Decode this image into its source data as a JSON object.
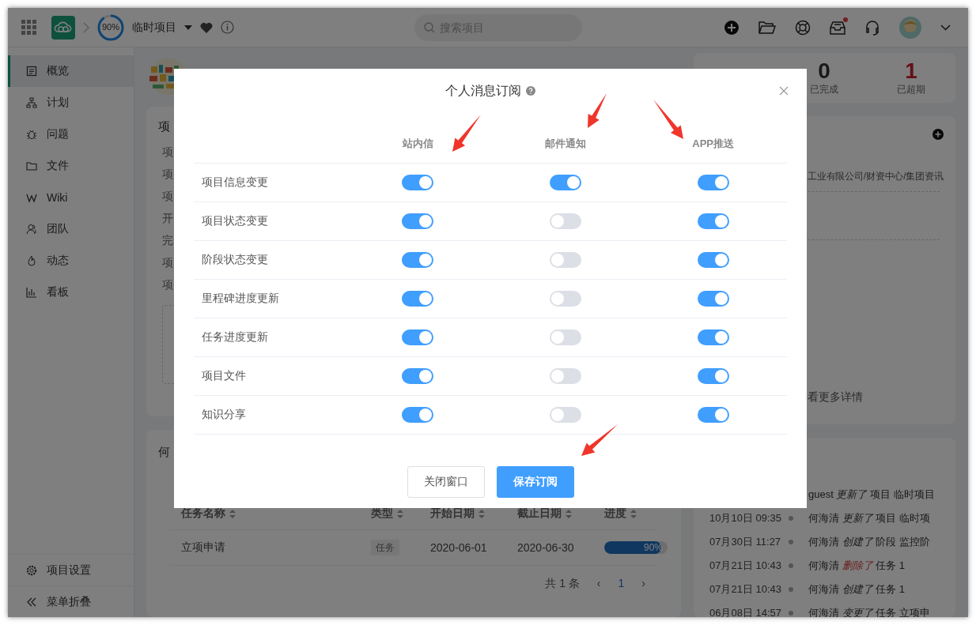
{
  "topbar": {
    "progress": {
      "level": 0.9,
      "label": "90%"
    },
    "project": "临时项目",
    "search": {
      "placeholder": "搜索项目"
    },
    "notification_dot": true
  },
  "sidebar": {
    "items": [
      {
        "label": "概览",
        "selected": true
      },
      {
        "label": "计划",
        "selected": false
      },
      {
        "label": "问题",
        "selected": false
      },
      {
        "label": "文件",
        "selected": false
      },
      {
        "label": "Wiki",
        "selected": false
      },
      {
        "label": "团队",
        "selected": false
      },
      {
        "label": "动态",
        "selected": false
      },
      {
        "label": "看板",
        "selected": false
      }
    ],
    "footer": [
      {
        "label": "项目设置"
      },
      {
        "label": "菜单折叠"
      }
    ]
  },
  "info_card": {
    "title": "项",
    "fields": [
      "项",
      "项",
      "项",
      "开",
      "完",
      "项",
      "项"
    ]
  },
  "stats": [
    {
      "value": "0",
      "label": "已完成",
      "kind": "normal"
    },
    {
      "value": "1",
      "label": "已超期",
      "kind": "overdue"
    }
  ],
  "org_card": {
    "path": "工业有限公司/财资中心/集团资讯",
    "more": "看更多详情"
  },
  "task_card": {
    "title": "何",
    "columns": [
      "任务名称",
      "类型",
      "开始日期",
      "截止日期",
      "进度"
    ],
    "rows": [
      {
        "name": "立项申请",
        "type": "任务",
        "start": "2020-06-01",
        "end": "2020-06-30",
        "level": 0.9,
        "progress": "90%"
      }
    ],
    "pagination": {
      "total": "共 1 条",
      "prev": "‹",
      "page": "1",
      "next": "›"
    }
  },
  "activity": [
    {
      "actor": "guest",
      "verb": "更新了",
      "kind": "normal",
      "object": "项目 临时项目"
    },
    {
      "time": "10月10日 09:35",
      "actor": "何海清",
      "verb": "更新了",
      "kind": "normal",
      "object": "项目 临时项"
    },
    {
      "time": "07月30日 11:27",
      "actor": "何海清",
      "verb": "创建了",
      "kind": "normal",
      "object": "阶段 监控阶"
    },
    {
      "time": "07月21日 10:43",
      "actor": "何海清",
      "verb": "删除了",
      "kind": "delete",
      "object": "任务 1"
    },
    {
      "time": "07月21日 10:43",
      "actor": "何海清",
      "verb": "创建了",
      "kind": "normal",
      "object": "任务 1"
    },
    {
      "time": "06月08日 14:57",
      "actor": "何海清",
      "verb": "变更了",
      "kind": "normal",
      "object": "任务 立项申"
    }
  ],
  "dialog": {
    "title": "个人消息订阅",
    "channels": [
      "站内信",
      "邮件通知",
      "APP推送"
    ],
    "rows": [
      {
        "label": "项目信息变更",
        "on": [
          true,
          true,
          true
        ]
      },
      {
        "label": "项目状态变更",
        "on": [
          true,
          false,
          true
        ]
      },
      {
        "label": "阶段状态变更",
        "on": [
          true,
          false,
          true
        ]
      },
      {
        "label": "里程碑进度更新",
        "on": [
          true,
          false,
          true
        ]
      },
      {
        "label": "任务进度更新",
        "on": [
          true,
          false,
          true
        ]
      },
      {
        "label": "项目文件",
        "on": [
          true,
          false,
          true
        ]
      },
      {
        "label": "知识分享",
        "on": [
          true,
          false,
          true
        ]
      }
    ],
    "buttons": [
      {
        "label": "关闭窗口",
        "kind": "secondary"
      },
      {
        "label": "保存订阅",
        "kind": "primary"
      }
    ]
  }
}
